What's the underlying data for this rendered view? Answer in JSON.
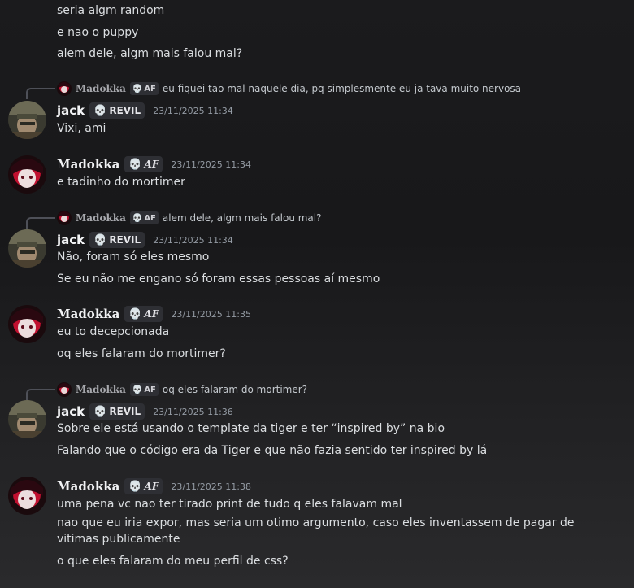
{
  "users": {
    "madokka": {
      "name": "Madokka",
      "tag_icon": "💀",
      "tag_text": "AF",
      "accent": "#d0103a"
    },
    "jack": {
      "name": "jack",
      "tag_icon": "💀",
      "tag_text": "REVIL",
      "accent": "#6b6a52"
    }
  },
  "messages": [
    {
      "id": "m0",
      "lines": [
        "seria algm random",
        "e nao o puppy",
        "alem dele, algm mais falou mal?"
      ]
    },
    {
      "id": "m1",
      "reply": {
        "author": "Madokka",
        "tag_icon": "💀",
        "tag_text": "AF",
        "text": "eu fiquei tao mal naquele dia, pq simplesmente eu ja tava muito nervosa"
      },
      "author": "jack",
      "tag_icon": "💀",
      "tag_text": "REVIL",
      "time": "23/11/2025 11:34",
      "lines": [
        "Vixi, ami"
      ]
    },
    {
      "id": "m2",
      "author": "Madokka",
      "tag_icon": "💀",
      "tag_text": "AF",
      "time": "23/11/2025 11:34",
      "lines": [
        "e tadinho do mortimer"
      ]
    },
    {
      "id": "m3",
      "reply": {
        "author": "Madokka",
        "tag_icon": "💀",
        "tag_text": "AF",
        "text": "alem dele, algm mais falou mal?"
      },
      "author": "jack",
      "tag_icon": "💀",
      "tag_text": "REVIL",
      "time": "23/11/2025 11:34",
      "lines": [
        "Não, foram só eles mesmo",
        "Se eu não me engano só foram essas pessoas aí mesmo"
      ]
    },
    {
      "id": "m4",
      "author": "Madokka",
      "tag_icon": "💀",
      "tag_text": "AF",
      "time": "23/11/2025 11:35",
      "lines": [
        "eu to decepcionada",
        "oq eles falaram do mortimer?"
      ]
    },
    {
      "id": "m5",
      "reply": {
        "author": "Madokka",
        "tag_icon": "💀",
        "tag_text": "AF",
        "text": "oq eles falaram do mortimer?"
      },
      "author": "jack",
      "tag_icon": "💀",
      "tag_text": "REVIL",
      "time": "23/11/2025 11:36",
      "lines": [
        "Sobre ele está usando o template da tiger e ter “inspired by” na bio",
        "Falando que o código era da Tiger e que não fazia sentido ter inspired by lá"
      ]
    },
    {
      "id": "m6",
      "author": "Madokka",
      "tag_icon": "💀",
      "tag_text": "AF",
      "time": "23/11/2025 11:38",
      "lines": [
        "uma pena vc nao ter tirado print de tudo q eles falavam mal",
        "nao que eu iria expor, mas seria um otimo argumento, caso eles inventassem de pagar de vitimas publicamente",
        "o que eles falaram do meu perfil de css?"
      ]
    }
  ]
}
